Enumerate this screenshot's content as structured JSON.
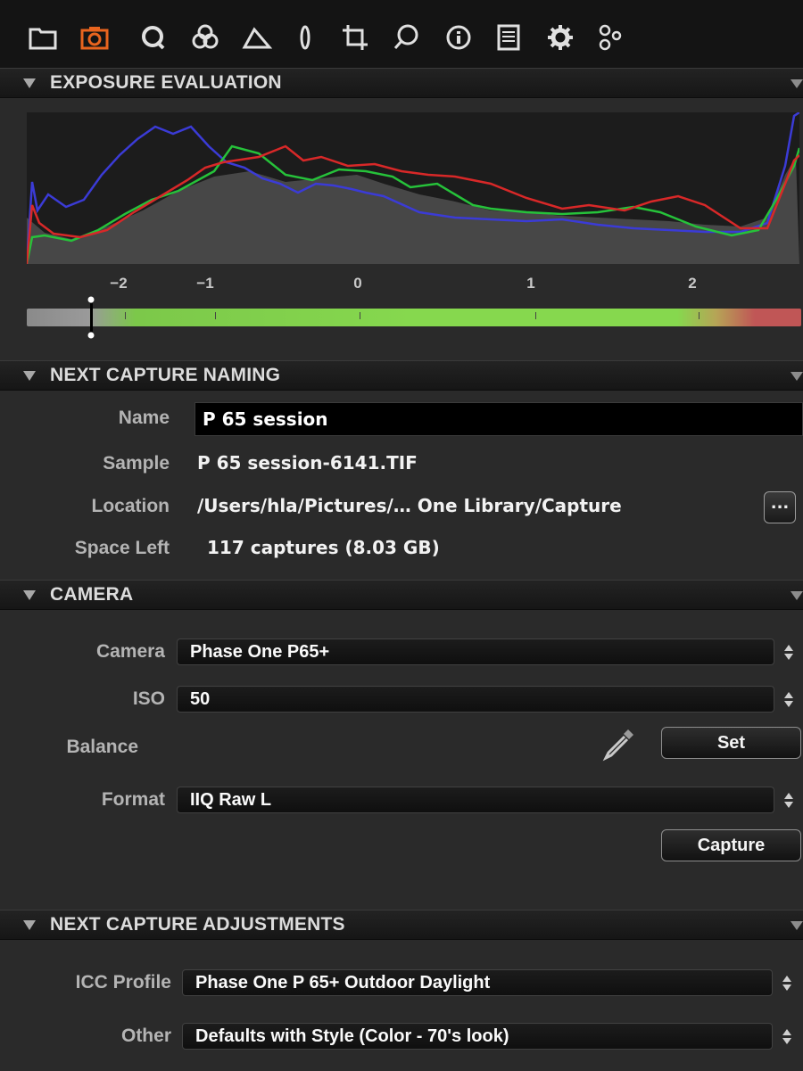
{
  "toolbar": {
    "tools": [
      {
        "icon": "folder-icon",
        "active": false
      },
      {
        "icon": "camera-icon",
        "active": true
      },
      {
        "icon": "quick-icon",
        "active": false
      },
      {
        "icon": "color-icon",
        "active": false
      },
      {
        "icon": "exposure-icon",
        "active": false
      },
      {
        "icon": "lens-icon",
        "active": false
      },
      {
        "icon": "crop-icon",
        "active": false
      },
      {
        "icon": "local-adjust-icon",
        "active": false
      },
      {
        "icon": "info-icon",
        "active": false
      },
      {
        "icon": "output-icon",
        "active": false
      },
      {
        "icon": "gear-icon",
        "active": false
      },
      {
        "icon": "batch-icon",
        "active": false
      }
    ],
    "active_color": "#e8641e"
  },
  "exposure": {
    "title": "EXPOSURE EVALUATION",
    "scale": [
      "−2",
      "−1",
      "0",
      "1",
      "2"
    ]
  },
  "naming": {
    "title": "NEXT CAPTURE NAMING",
    "name_label": "Name",
    "name_value": "P 65 session",
    "sample_label": "Sample",
    "sample_value": "P 65 session-6141.TIF",
    "location_label": "Location",
    "location_value": "/Users/hla/Pictures/… One Library/Capture",
    "location_button": "...",
    "space_label": "Space Left",
    "space_value": "117 captures (8.03 GB)"
  },
  "camera": {
    "title": "CAMERA",
    "camera_label": "Camera",
    "camera_value": "Phase One P65+",
    "iso_label": "ISO",
    "iso_value": "50",
    "balance_label": "Balance",
    "set_button": "Set",
    "format_label": "Format",
    "format_value": "IIQ Raw L",
    "capture_button": "Capture"
  },
  "adjustments": {
    "title": "NEXT CAPTURE ADJUSTMENTS",
    "icc_label": "ICC Profile",
    "icc_value": "Phase One P 65+ Outdoor Daylight",
    "other_label": "Other",
    "other_value": "Defaults with Style (Color - 70's look)"
  }
}
